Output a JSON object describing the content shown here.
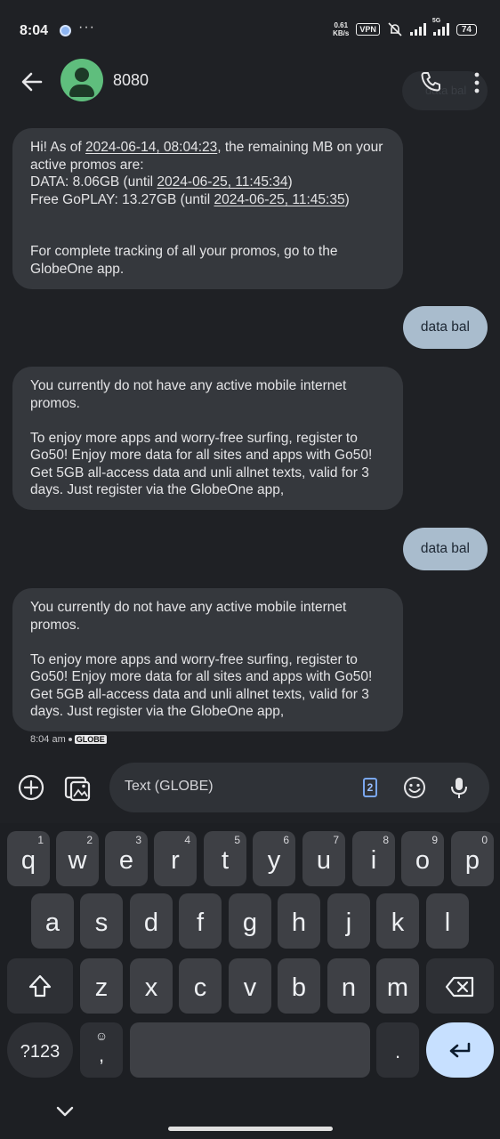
{
  "status_bar": {
    "time": "8:04",
    "more": "···",
    "net_speed_value": "0.61",
    "net_speed_unit": "KB/s",
    "vpn": "VPN",
    "network": "5G",
    "battery": "74"
  },
  "header": {
    "contact": "8080",
    "ghost_text": "data bal"
  },
  "messages": [
    {
      "type": "incoming"
    },
    {
      "type": "outgoing",
      "text": "data bal"
    },
    {
      "type": "incoming",
      "text": "You currently do not have any active mobile internet promos.\n\nTo enjoy more apps and worry-free surfing, register to Go50! Enjoy more data for all sites and apps with Go50! Get 5GB all-access data and unli allnet texts, valid for 3 days. Just register via the GlobeOne app,"
    },
    {
      "type": "outgoing",
      "text": "data bal"
    },
    {
      "type": "incoming",
      "text": "You currently do not have any active mobile internet promos.\n\nTo enjoy more apps and worry-free surfing, register to Go50! Enjoy more data for all sites and apps with Go50! Get 5GB all-access data and unli allnet texts, valid for 3 days. Just register via the GlobeOne app,"
    }
  ],
  "msg1": {
    "p1": "Hi! As of ",
    "d1": "2024-06-14, 08:04:23",
    "p2": ", the remaining MB on your active promos are:\nDATA: 8.06GB (until ",
    "d2": "2024-06-25, 11:45:34",
    "p3": ")\nFree GoPLAY: 13.27GB (until ",
    "d3": "2024-06-25, 11:45:35",
    "p4": ")\n\n\nFor complete tracking of all your promos, go to the GlobeOne app."
  },
  "last_meta": {
    "time": "8:04 am",
    "sim": "GLOBE"
  },
  "compose": {
    "placeholder": "Text (GLOBE)",
    "sim_slot": "2"
  },
  "keyboard": {
    "row1": [
      {
        "key": "q",
        "hint": "1"
      },
      {
        "key": "w",
        "hint": "2"
      },
      {
        "key": "e",
        "hint": "3"
      },
      {
        "key": "r",
        "hint": "4"
      },
      {
        "key": "t",
        "hint": "5"
      },
      {
        "key": "y",
        "hint": "6"
      },
      {
        "key": "u",
        "hint": "7"
      },
      {
        "key": "i",
        "hint": "8"
      },
      {
        "key": "o",
        "hint": "9"
      },
      {
        "key": "p",
        "hint": "0"
      }
    ],
    "row2": [
      "a",
      "s",
      "d",
      "f",
      "g",
      "h",
      "j",
      "k",
      "l"
    ],
    "row3": [
      "z",
      "x",
      "c",
      "v",
      "b",
      "n",
      "m"
    ],
    "symbols": "?123",
    "comma": ",",
    "period": ".",
    "emoji_hint": "☺"
  },
  "colors": {
    "background": "#1f2125",
    "incoming_bubble": "#35383d",
    "outgoing_bubble": "#a9bccd",
    "avatar": "#5fbe7d",
    "enter_key": "#c7e0ff"
  }
}
